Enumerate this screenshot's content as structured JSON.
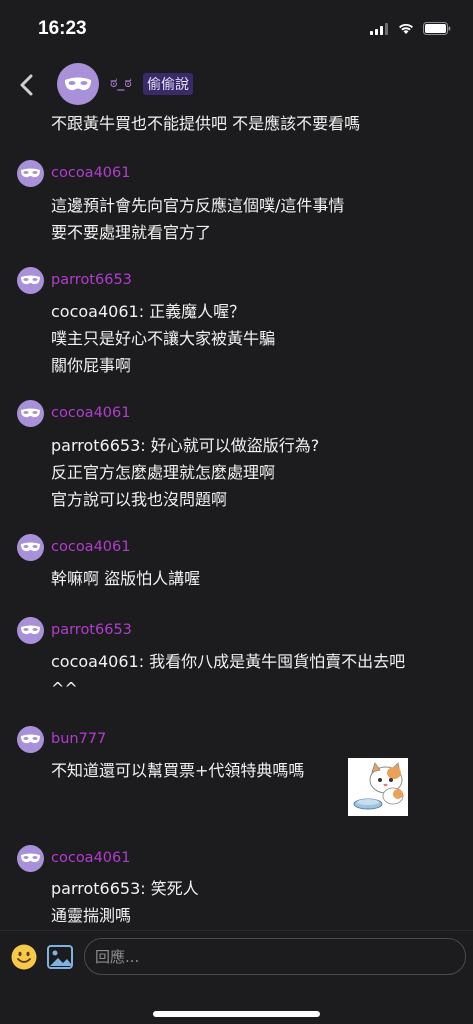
{
  "status_bar": {
    "time": "16:23"
  },
  "header": {
    "author": "ಠ_ಠ",
    "badge": "偷偷說",
    "first_text": "不跟黃牛買也不能提供吧 不是應該不要看嗎"
  },
  "messages": [
    {
      "author": "cocoa4061",
      "text": "這邊預計會先向官方反應這個噗/這件事情\n要不要處理就看官方了"
    },
    {
      "author": "parrot6653",
      "text": "cocoa4061: 正義魔人喔？\n噗主只是好心不讓大家被黃牛騙\n關你屁事啊"
    },
    {
      "author": "cocoa4061",
      "text": "parrot6653: 好心就可以做盜版行為?\n反正官方怎麼處理就怎麼處理啊\n官方說可以我也沒問題啊"
    },
    {
      "author": "cocoa4061",
      "text": "幹嘛啊 盜版怕人講喔"
    },
    {
      "author": "parrot6653",
      "text": "cocoa4061: 我看你八成是黃牛囤貨怕賣不出去吧\n^^"
    },
    {
      "author": "bun777",
      "text": "不知道還可以幫買票+代領特典嗎嗎",
      "sticker": "cat-with-bowl-sticker"
    },
    {
      "author": "cocoa4061",
      "text": "parrot6653: 笑死人\n通靈揣測嗎"
    }
  ],
  "reply": {
    "placeholder": "回應..."
  },
  "colors": {
    "background": "#1c1c1e",
    "author_name": "#b23ccf",
    "avatar": "#a891d8",
    "badge_bg": "#3a2a6a"
  }
}
